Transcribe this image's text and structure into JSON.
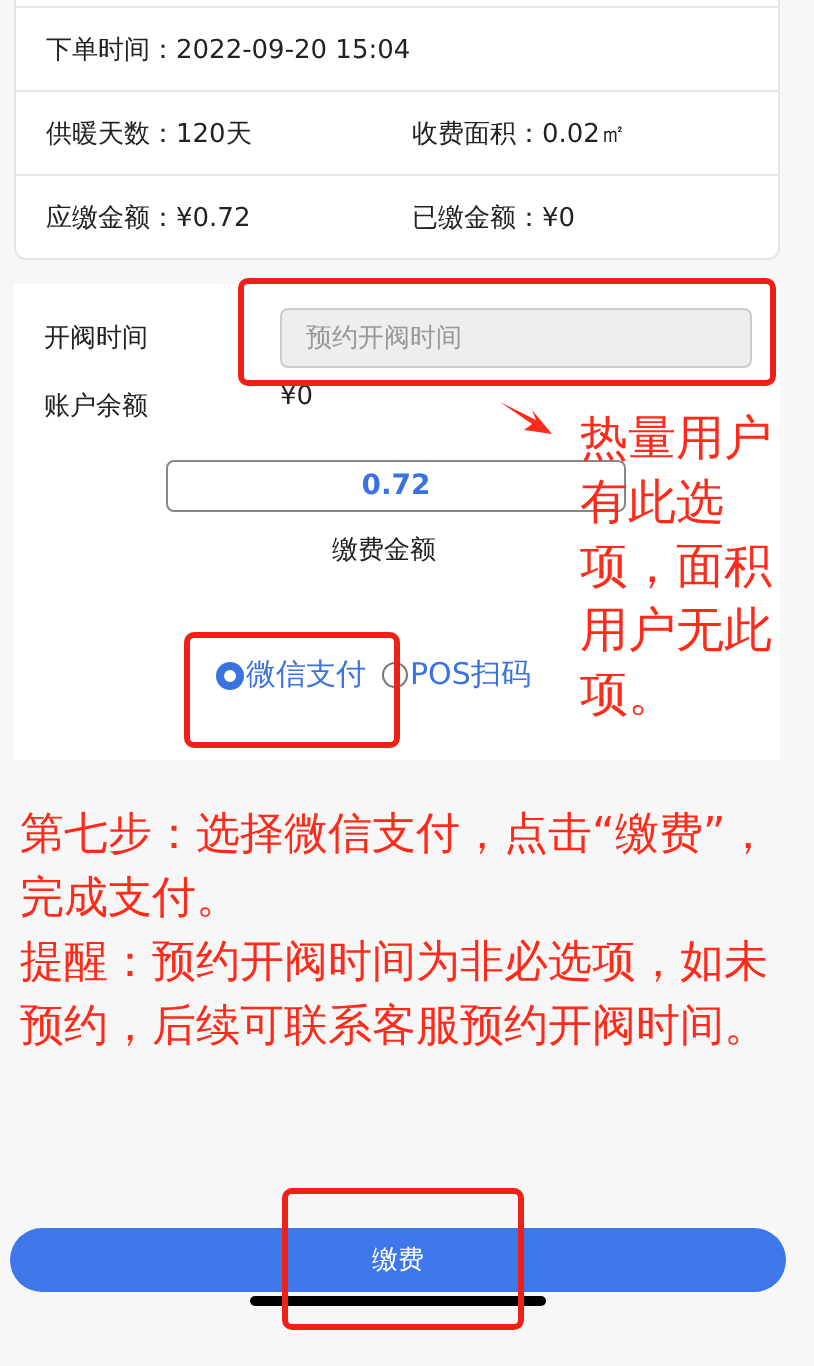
{
  "order_info": {
    "rows": [
      [
        {
          "label": "下单时间：",
          "value": "2022-09-20 15:04"
        }
      ],
      [
        {
          "label": "供暖天数：",
          "value": "120天"
        },
        {
          "label": "收费面积：",
          "value": "0.02㎡"
        }
      ],
      [
        {
          "label": "应缴金额：",
          "value": "¥0.72"
        },
        {
          "label": "已缴金额：",
          "value": "¥0"
        }
      ]
    ]
  },
  "form": {
    "open_time": {
      "label": "开阀时间",
      "placeholder": "预约开阀时间"
    },
    "balance": {
      "label": "账户余额",
      "value": "¥0"
    },
    "amount": {
      "value": "0.72",
      "caption": "缴费金额"
    },
    "payment_methods": [
      {
        "label": "微信支付",
        "selected": true
      },
      {
        "label": "POS扫码",
        "selected": false
      }
    ]
  },
  "annotations": {
    "side_note": "热量用户有此选项，面积用户无此项。",
    "instructions": [
      "第七步：选择微信支付，点击“缴费”，完成支付。",
      "提醒：预约开阀时间为非必选项，如未预约，后续可联系客服预约开阀时间。"
    ]
  },
  "pay_button": "缴费"
}
